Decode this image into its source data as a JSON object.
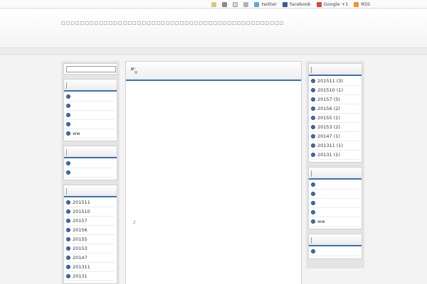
{
  "topbar": {
    "links": [
      {
        "icon": "pen-icon"
      },
      {
        "icon": "user-icon"
      },
      {
        "icon": "mail-icon"
      },
      {
        "icon": "home-icon"
      },
      {
        "icon": "twitter-icon",
        "label": "twitter"
      },
      {
        "icon": "facebook-icon",
        "label": "facebook"
      },
      {
        "icon": "google-plus-icon",
        "label": "Google +1"
      },
      {
        "icon": "rss-icon",
        "label": "RSS"
      }
    ]
  },
  "header": {
    "description": "□□□□□□□□□□□□□□□□□□□□□□□□□□□□□□□□□□□□□□□□□□□□□□□"
  },
  "left_sidebar": {
    "search": {
      "value": ""
    },
    "widget1": {
      "title": "",
      "items": [
        "",
        "",
        "",
        "",
        "ww"
      ]
    },
    "widget2": {
      "title": "",
      "items": [
        "",
        ""
      ]
    },
    "widget3": {
      "title": "",
      "items": [
        "201511",
        "201510",
        "20157",
        "20156",
        "20155",
        "20153",
        "20147",
        "201311",
        "20131"
      ]
    }
  },
  "main": {
    "title": "",
    "mark": "♪"
  },
  "right_sidebar": {
    "archives": {
      "title": "",
      "items": [
        "201511 (3)",
        "201510 (1)",
        "20157 (5)",
        "20156 (2)",
        "20155 (1)",
        "20153 (2)",
        "20147 (1)",
        "201311 (1)",
        "20131 (1)"
      ]
    },
    "widget2": {
      "title": "",
      "items": [
        "",
        "",
        "",
        "",
        "ww"
      ]
    },
    "widget3": {
      "title": "",
      "items": [
        ""
      ]
    }
  },
  "colors": {
    "accent": "#3b6fae",
    "background": "#f3f3f3"
  }
}
